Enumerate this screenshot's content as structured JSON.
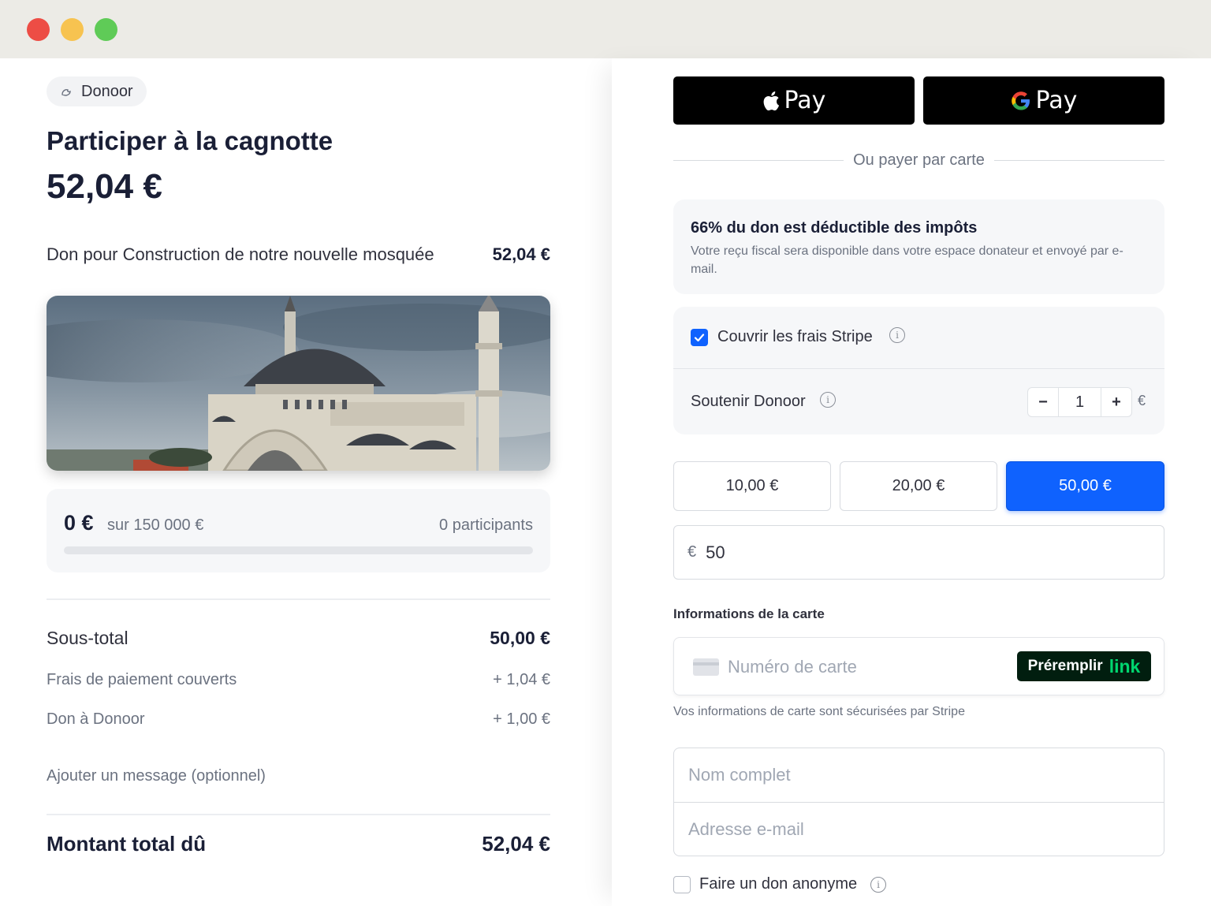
{
  "window": {
    "controls": [
      "close",
      "minimize",
      "maximize"
    ]
  },
  "left": {
    "brand": "Donoor",
    "title": "Participer à la cagnotte",
    "amount": "52,04 €",
    "donation_line": {
      "label": "Don pour Construction de notre nouvelle mosquée",
      "value": "52,04 €"
    },
    "hero_image_icon": "mosque-image",
    "progress": {
      "raised": "0 €",
      "goal": "sur 150 000 €",
      "participants": "0 participants",
      "fraction": 0
    },
    "summary": {
      "subtotal_label": "Sous-total",
      "subtotal_value": "50,00 €",
      "fee_label": "Frais de paiement couverts",
      "fee_value": "+ 1,04 €",
      "donoor_label": "Don à Donoor",
      "donoor_value": "+ 1,00 €",
      "add_message": "Ajouter un message (optionnel)",
      "total_label": "Montant total dû",
      "total_value": "52,04 €"
    }
  },
  "right": {
    "apple_pay_label": "Pay",
    "google_pay_label": "Pay",
    "or_pay_card": "Ou payer par carte",
    "tax": {
      "heading": "66% du don est déductible des impôts",
      "text": "Votre reçu fiscal sera disponible dans votre espace donateur et envoyé par e-mail."
    },
    "cover_fees": {
      "label": "Couvrir les frais Stripe",
      "checked": true
    },
    "support": {
      "label": "Soutenir Donoor",
      "minus": "−",
      "value": "1",
      "plus": "+",
      "suffix": "€"
    },
    "amount_options": [
      "10,00 €",
      "20,00 €",
      "50,00 €"
    ],
    "selected_amount_index": 2,
    "custom_amount": {
      "currency": "€",
      "value": "50"
    },
    "card_section_title": "Informations de la carte",
    "card_number_placeholder": "Numéro de carte",
    "prefill_label": "Préremplir",
    "prefill_brand": "link",
    "secure_note": "Vos informations de carte sont sécurisées par Stripe",
    "name_placeholder": "Nom complet",
    "email_placeholder": "Adresse e-mail",
    "anonymous": {
      "label": "Faire un don anonyme",
      "checked": false
    },
    "colors": {
      "accent": "#0f62fe",
      "link_green": "#00d66f"
    }
  }
}
